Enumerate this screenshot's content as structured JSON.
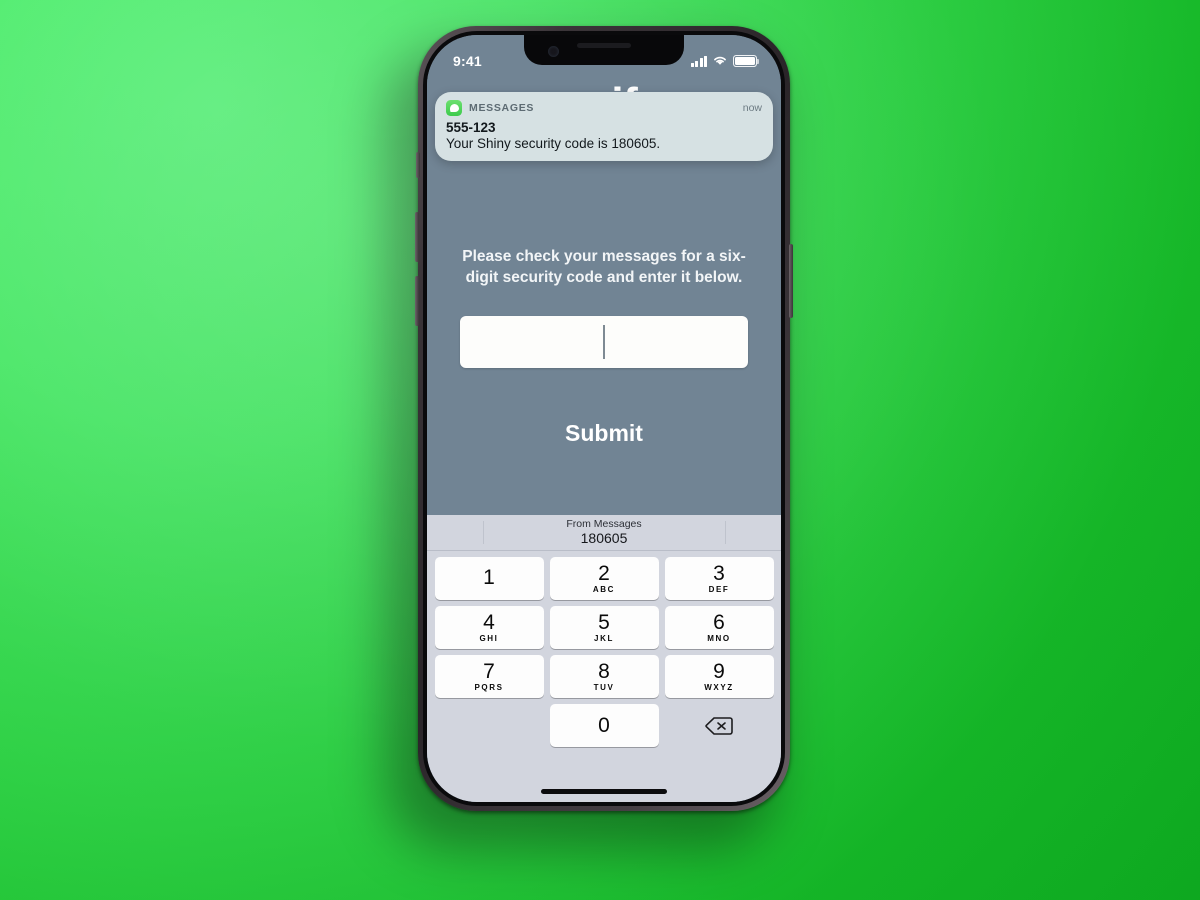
{
  "scene": {
    "background_color_start": "#56f077",
    "background_color_end": "#0fbb23",
    "device": "iphone"
  },
  "status_bar": {
    "time": "9:41",
    "signal_icon": "cellular-signal-icon",
    "wifi_icon": "wifi-icon",
    "battery_icon": "battery-icon"
  },
  "notification": {
    "app_icon": "messages-app-icon",
    "app_name": "MESSAGES",
    "timestamp": "now",
    "sender": "555-123",
    "message": "Your Shiny security code is 180605."
  },
  "app": {
    "title": "verify",
    "prompt": "Please check your messages for a six-digit security code and enter it below.",
    "code_input": {
      "value": "",
      "placeholder": ""
    },
    "submit_label": "Submit",
    "background_color": "#718494"
  },
  "keyboard": {
    "autofill": {
      "label": "From Messages",
      "value": "180605"
    },
    "background_color": "#d2d5de",
    "rows": [
      [
        {
          "num": "1",
          "sub": ""
        },
        {
          "num": "2",
          "sub": "ABC"
        },
        {
          "num": "3",
          "sub": "DEF"
        }
      ],
      [
        {
          "num": "4",
          "sub": "GHI"
        },
        {
          "num": "5",
          "sub": "JKL"
        },
        {
          "num": "6",
          "sub": "MNO"
        }
      ],
      [
        {
          "num": "7",
          "sub": "PQRS"
        },
        {
          "num": "8",
          "sub": "TUV"
        },
        {
          "num": "9",
          "sub": "WXYZ"
        }
      ]
    ],
    "zero_key": {
      "num": "0",
      "sub": ""
    },
    "delete_icon": "backspace-delete-icon"
  }
}
